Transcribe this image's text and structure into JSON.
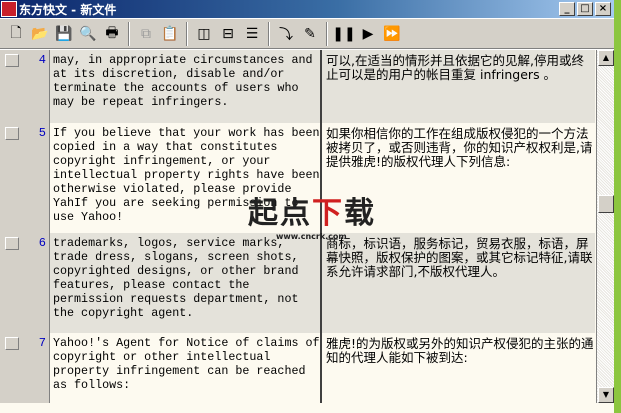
{
  "window": {
    "title": "东方快文 - 新文件",
    "app_icon_text": "东方快文",
    "minimize": "_",
    "maximize": "□",
    "close": "×"
  },
  "toolbar": [
    {
      "icon": "new-file-icon",
      "g": "🗋"
    },
    {
      "icon": "open-folder-icon",
      "g": "📂"
    },
    {
      "icon": "save-icon",
      "g": "💾"
    },
    {
      "icon": "print-preview-icon",
      "g": "🔍"
    },
    {
      "icon": "print-icon",
      "g": "🖶"
    },
    {
      "icon": "copy-icon",
      "g": "⧉"
    },
    {
      "icon": "paste-icon",
      "g": "📋"
    },
    {
      "icon": "side-by-side-layout-icon",
      "g": "◫"
    },
    {
      "icon": "top-bottom-layout-icon",
      "g": "⊟"
    },
    {
      "icon": "single-layout-icon",
      "g": "☰"
    },
    {
      "icon": "translate-icon",
      "g": "⤵"
    },
    {
      "icon": "edit-icon",
      "g": "✎"
    },
    {
      "icon": "pause-icon",
      "g": "❚❚"
    },
    {
      "icon": "play-icon",
      "g": "▶"
    },
    {
      "icon": "fast-forward-icon",
      "g": "⏩"
    }
  ],
  "rows": [
    {
      "num": "4",
      "en": "may, in appropriate circumstances and\nat its discretion, disable and/or\nterminate the accounts of users who\nmay be repeat infringers.",
      "cn": "可以,在适当的情形并且依据它的见解,停用或终止可以是的用户的帐目重复\ninfringers 。"
    },
    {
      "num": "5",
      "en": "If you believe that your work has been\ncopied in a way that constitutes\ncopyright infringement, or your\nintellectual property rights have been\notherwise violated, please provide\nYahIf you are seeking permission to\nuse Yahoo!",
      "cn": "如果你相信你的工作在组成版权侵犯的一个方法被拷贝了，或否则违背，你的知识产权权利是,请提供雅虎!的版权代理人下列信息:"
    },
    {
      "num": "6",
      "en": "trademarks, logos, service marks,\ntrade dress, slogans, screen shots,\ncopyrighted designs, or other brand\nfeatures, please contact the\npermission requests department, not\nthe copyright agent.",
      "cn": "商标，标识语，服务标记，贸易衣服，标语，屏幕快照，版权保护的图案，或其它标记特征,请联系允许请求部门,不版权代理人。"
    },
    {
      "num": "7",
      "en": "Yahoo!'s Agent for Notice of claims of\ncopyright or other intellectual\nproperty infringement can be reached\nas follows:",
      "cn": "雅虎!的为版权或另外的知识产权侵犯的主张的通知的代理人能如下被到达:"
    }
  ],
  "watermark": {
    "logo": "起点下载",
    "url": "www.cncrk.com"
  }
}
